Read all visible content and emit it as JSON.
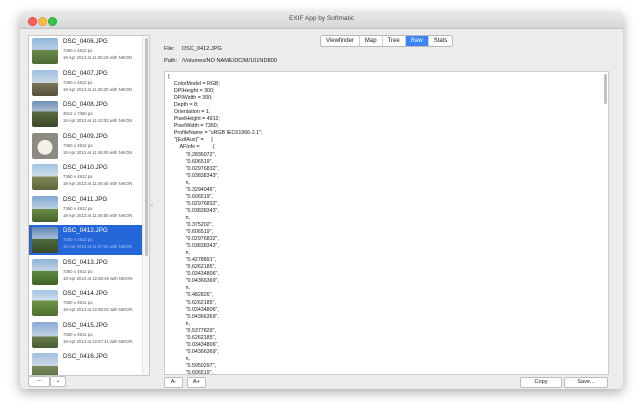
{
  "window": {
    "title": "EXIF App by Softmatic"
  },
  "files": [
    {
      "name": "DSC_0406.JPG",
      "dimensions": "7360 x 4912 px.",
      "date": "18 Apr 2013 at 11:35:18 with NIKON",
      "selected": false
    },
    {
      "name": "DSC_0407.JPG",
      "dimensions": "7360 x 4912 px.",
      "date": "18 Apr 2013 at 11:36:30 with NIKON",
      "selected": false
    },
    {
      "name": "DSC_0408.JPG",
      "dimensions": "4912 x 7360 px.",
      "date": "18 Apr 2013 at 11:43:03 with NIKON",
      "selected": false
    },
    {
      "name": "DSC_0409.JPG",
      "dimensions": "7360 x 4912 px.",
      "date": "18 Apr 2013 at 11:45:00 with NIKON",
      "selected": false
    },
    {
      "name": "DSC_0410.JPG",
      "dimensions": "7360 x 4912 px.",
      "date": "18 Apr 2013 at 11:46:48 with NIKON",
      "selected": false
    },
    {
      "name": "DSC_0411.JPG",
      "dimensions": "7360 x 4912 px.",
      "date": "18 Apr 2013 at 11:46:55 with NIKON",
      "selected": false
    },
    {
      "name": "DSC_0412.JPG",
      "dimensions": "7360 x 4912 px.",
      "date": "18 Apr 2013 at 11:47:02 with NIKON",
      "selected": true
    },
    {
      "name": "DSC_0413.JPG",
      "dimensions": "7360 x 4912 px.",
      "date": "18 Apr 2013 at 12:55:45 with NIKON",
      "selected": false
    },
    {
      "name": "DSC_0414.JPG",
      "dimensions": "7360 x 4912 px.",
      "date": "18 Apr 2013 at 12:56:02 with NIKON",
      "selected": false
    },
    {
      "name": "DSC_0415.JPG",
      "dimensions": "7360 x 4912 px.",
      "date": "18 Apr 2013 at 12:57:41 with NIKON",
      "selected": false
    },
    {
      "name": "DSC_0416.JPG",
      "dimensions": "",
      "date": "",
      "selected": false
    }
  ],
  "sidebar_buttons": {
    "remove": "--",
    "options": "⌄"
  },
  "tabs": [
    {
      "label": "Viewfinder",
      "active": false
    },
    {
      "label": "Map",
      "active": false
    },
    {
      "label": "Tree",
      "active": false
    },
    {
      "label": "Raw",
      "active": true
    },
    {
      "label": "Stats",
      "active": false
    }
  ],
  "info": {
    "file_label": "File:",
    "file_value": "DSC_0412.JPG",
    "path_label": "Path:",
    "path_value": "/Volumes/NO NAME/DCIM/101ND800"
  },
  "raw_lines": [
    "{",
    "    ColorModel = RGB;",
    "    DPIHeight = 300;",
    "    DPIWidth = 300;",
    "    Depth = 8;",
    "    Orientation = 1;",
    "    PixelHeight = 4912;",
    "    PixelWidth = 7360;",
    "    ProfileName = \"sRGB IEC61966-2.1\";",
    "    \"{ExifAux}\" =     {",
    "        AFInfo =         (",
    "            \"0.2836072\",",
    "            \"0.606519\",",
    "            \"0.02976832\",",
    "            \"0.03838343\",",
    "            n,",
    "            \"0.3294046\",",
    "            \"0.606519\",",
    "            \"0.02976832\",",
    "            \"0.03838343\",",
    "            n,",
    "            \"0.375202\",",
    "            \"0.606519\",",
    "            \"0.02976832\",",
    "            \"0.03838343\",",
    "            n,",
    "            \"0.4278891\",",
    "            \"0.6262185\",",
    "            \"0.03434806\",",
    "            \"0.04366369\",",
    "            n,",
    "            \"0.482826\",",
    "            \"0.6262185\",",
    "            \"0.03434806\",",
    "            \"0.04366369\",",
    "            n,",
    "            \"0.5377829\",",
    "            \"0.6262185\",",
    "            \"0.03434806\",",
    "            \"0.04366369\",",
    "            n,",
    "            \"0.5950297\",",
    "            \"0.606519\",",
    "            \"0.02976832\",",
    "            \"0.03838343\",",
    "            n,"
  ],
  "bottom_buttons": {
    "font_smaller": "A-",
    "font_larger": "A+",
    "copy": "Copy",
    "save": "Save..."
  }
}
